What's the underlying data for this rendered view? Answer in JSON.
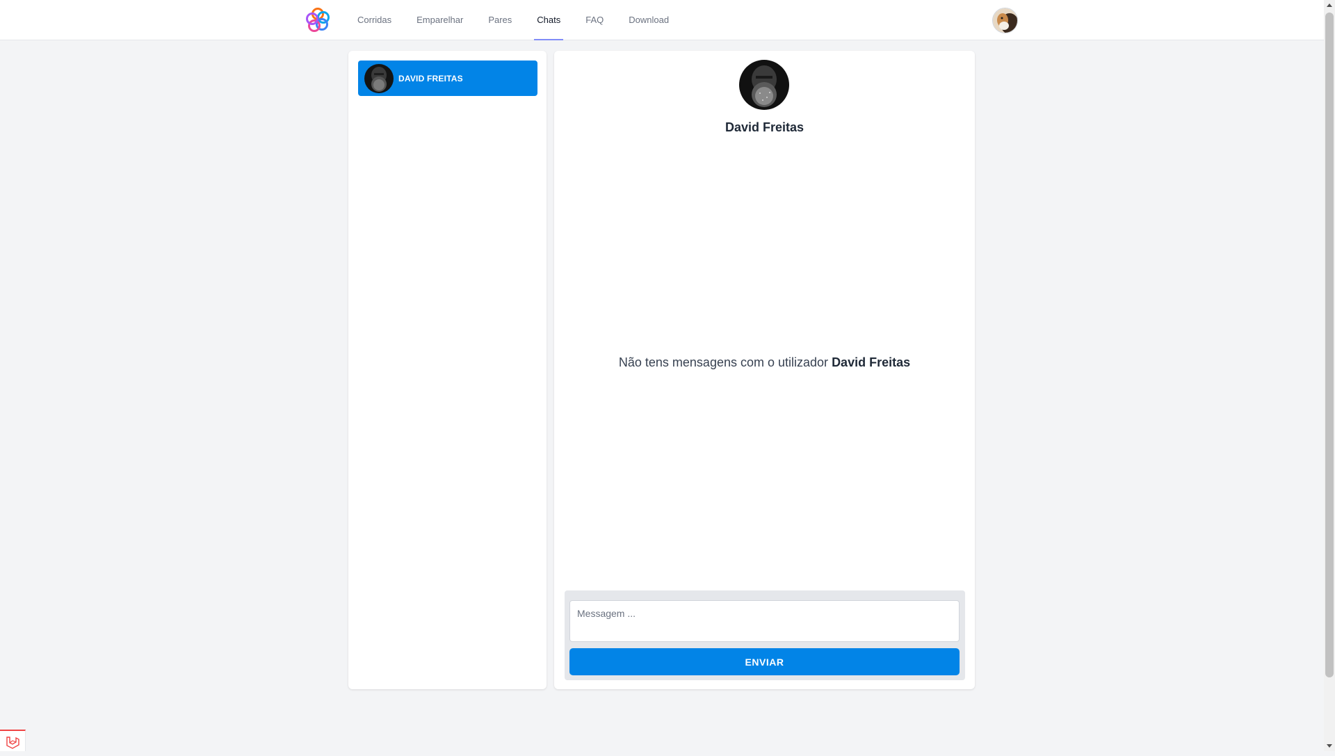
{
  "nav": {
    "items": [
      {
        "label": "Corridas",
        "active": false
      },
      {
        "label": "Emparelhar",
        "active": false
      },
      {
        "label": "Pares",
        "active": false
      },
      {
        "label": "Chats",
        "active": true
      },
      {
        "label": "FAQ",
        "active": false
      },
      {
        "label": "Download",
        "active": false
      }
    ]
  },
  "sidebar": {
    "contacts": [
      {
        "name": "DAVID FREITAS",
        "selected": true
      }
    ]
  },
  "chat": {
    "contact_name": "David Freitas",
    "empty_text": "Não tens mensagens com o utilizador",
    "empty_name": "David Freitas",
    "input_placeholder": "Messagem ...",
    "send_label": "ENVIAR"
  },
  "colors": {
    "accent": "#0284e7",
    "active_underline": "#818cf8",
    "background": "#f3f4f6"
  }
}
